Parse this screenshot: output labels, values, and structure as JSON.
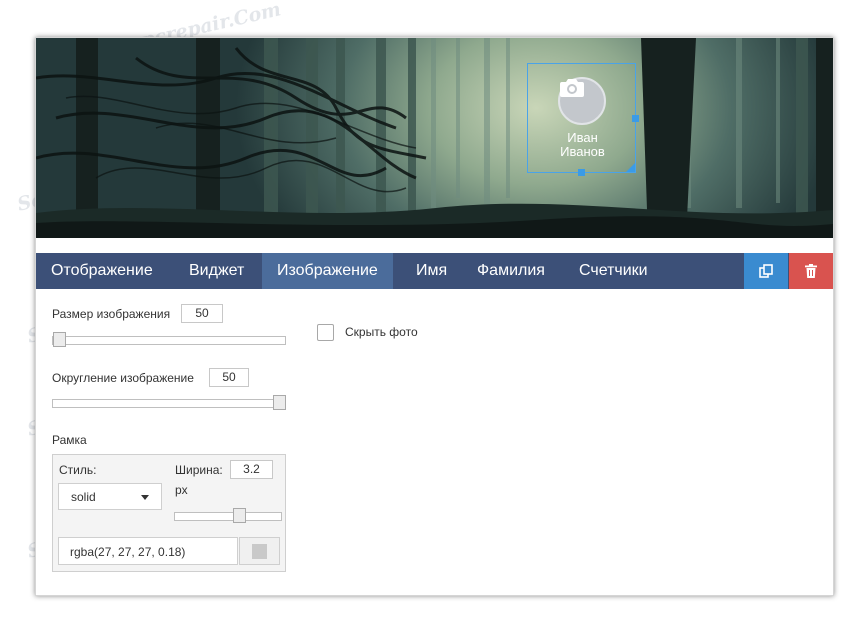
{
  "profile": {
    "first_name": "Иван",
    "last_name": "Иванов"
  },
  "tabs": [
    {
      "label": "Отображение",
      "active": false
    },
    {
      "label": "Виджет",
      "active": false
    },
    {
      "label": "Изображение",
      "active": true
    },
    {
      "label": "Имя",
      "active": false
    },
    {
      "label": "Фамилия",
      "active": false
    },
    {
      "label": "Счетчики",
      "active": false
    }
  ],
  "toolbar": {
    "copy_icon": "copy-icon",
    "delete_icon": "trash-icon",
    "copy_color": "#3a8bd0",
    "delete_color": "#d9534f"
  },
  "image_settings": {
    "size_label": "Размер изображения",
    "size_value": "50",
    "size_slider_fraction": 0.0,
    "rounding_label": "Округление изображение",
    "rounding_value": "50",
    "rounding_slider_fraction": 1.0,
    "hide_photo_label": "Скрыть фото",
    "hide_photo_checked": false
  },
  "frame": {
    "section_label": "Рамка",
    "style_label": "Стиль:",
    "style_value": "solid",
    "width_label": "Ширина:",
    "width_value": "3.2",
    "width_unit": "px",
    "width_slider_fraction": 0.55,
    "color_value": "rgba(27, 27, 27, 0.18)",
    "color_swatch": "#c9c9c9"
  },
  "watermark": "Soringpcrepair.Com",
  "colors": {
    "tab_bar": "#3c5078",
    "tab_active": "#4b6c9b",
    "selection": "#3b9be6"
  }
}
